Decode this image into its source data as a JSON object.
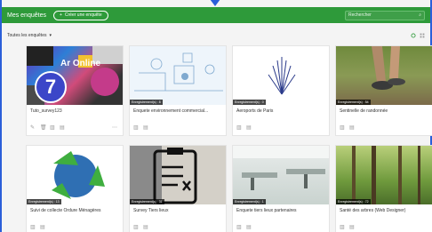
{
  "header": {
    "title": "Mes enquêtes",
    "create_label": "Créer une enquête",
    "search_placeholder": "Rechercher"
  },
  "filter": {
    "label": "Toutes les enquêtes"
  },
  "colors": {
    "header": "#2e9a3a",
    "frame": "#2b5fd9"
  },
  "cards": [
    {
      "name": "Tuto_survey123",
      "badge": "",
      "overlay_text": "Ar Online",
      "step_number": "7"
    },
    {
      "name": "Enquete environnement commercial...",
      "badge": "Enregistrement(s) : 8"
    },
    {
      "name": "Aeroports de Paris",
      "badge": "Enregistrement(s) : 0"
    },
    {
      "name": "Sentinelle de randonnée",
      "badge": "Enregistrement(s) : 54"
    },
    {
      "name": "Suivi de collecte Ordure Ménagères",
      "badge": "Enregistrement(s) : 13"
    },
    {
      "name": "Survey Tiers lieux",
      "badge": "Enregistrement(s) : 31"
    },
    {
      "name": "Enquete tiers lieux partenaires",
      "badge": "Enregistrement(s) : 1"
    },
    {
      "name": "Santé des arbres (Web Designer)",
      "badge": "Enregistrement(s) : 72"
    }
  ]
}
